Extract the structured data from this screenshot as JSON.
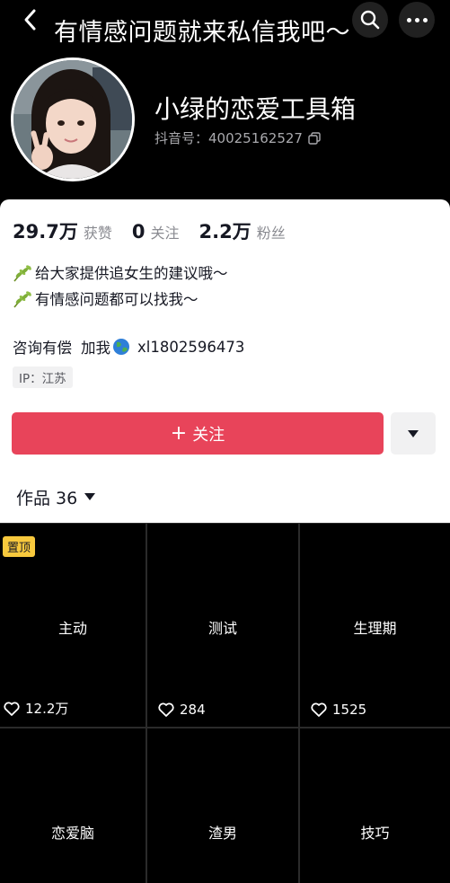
{
  "header": {
    "banner_text": "有情感问题就来私信我吧～",
    "back_icon": "chevron-left-icon",
    "search_icon": "search-icon",
    "more_icon": "more-horizontal-icon"
  },
  "profile": {
    "nickname": "小绿的恋爱工具箱",
    "douyin_id": "抖音号：40025162527",
    "copy_icon": "copy-icon"
  },
  "stats": [
    {
      "value": "29.7万",
      "label": "获赞"
    },
    {
      "value": "0",
      "label": "关注"
    },
    {
      "value": "2.2万",
      "label": "粉丝"
    }
  ],
  "bio": {
    "lines": [
      "给大家提供追女生的建议哦～",
      "有情感问题都可以找我～"
    ],
    "line_icon": "leaf-icon"
  },
  "contact": {
    "text1": "咨询有偿",
    "text2": "加我",
    "globe_icon": "globe-icon",
    "handle": "xl1802596473"
  },
  "ip_tag": "IP：江苏",
  "actions": {
    "follow_label": "关注",
    "plus": "+",
    "accent_color": "#e8445a"
  },
  "works_tab": {
    "label": "作品 36"
  },
  "videos": [
    {
      "title": "主动",
      "likes": "12.2万",
      "pinned": true,
      "pin_label": "置顶"
    },
    {
      "title": "测试",
      "likes": "284",
      "pinned": false
    },
    {
      "title": "生理期",
      "likes": "1525",
      "pinned": false
    },
    {
      "title": "恋爱脑",
      "likes": "",
      "pinned": false
    },
    {
      "title": "渣男",
      "likes": "",
      "pinned": false
    },
    {
      "title": "技巧",
      "likes": "",
      "pinned": false
    }
  ]
}
